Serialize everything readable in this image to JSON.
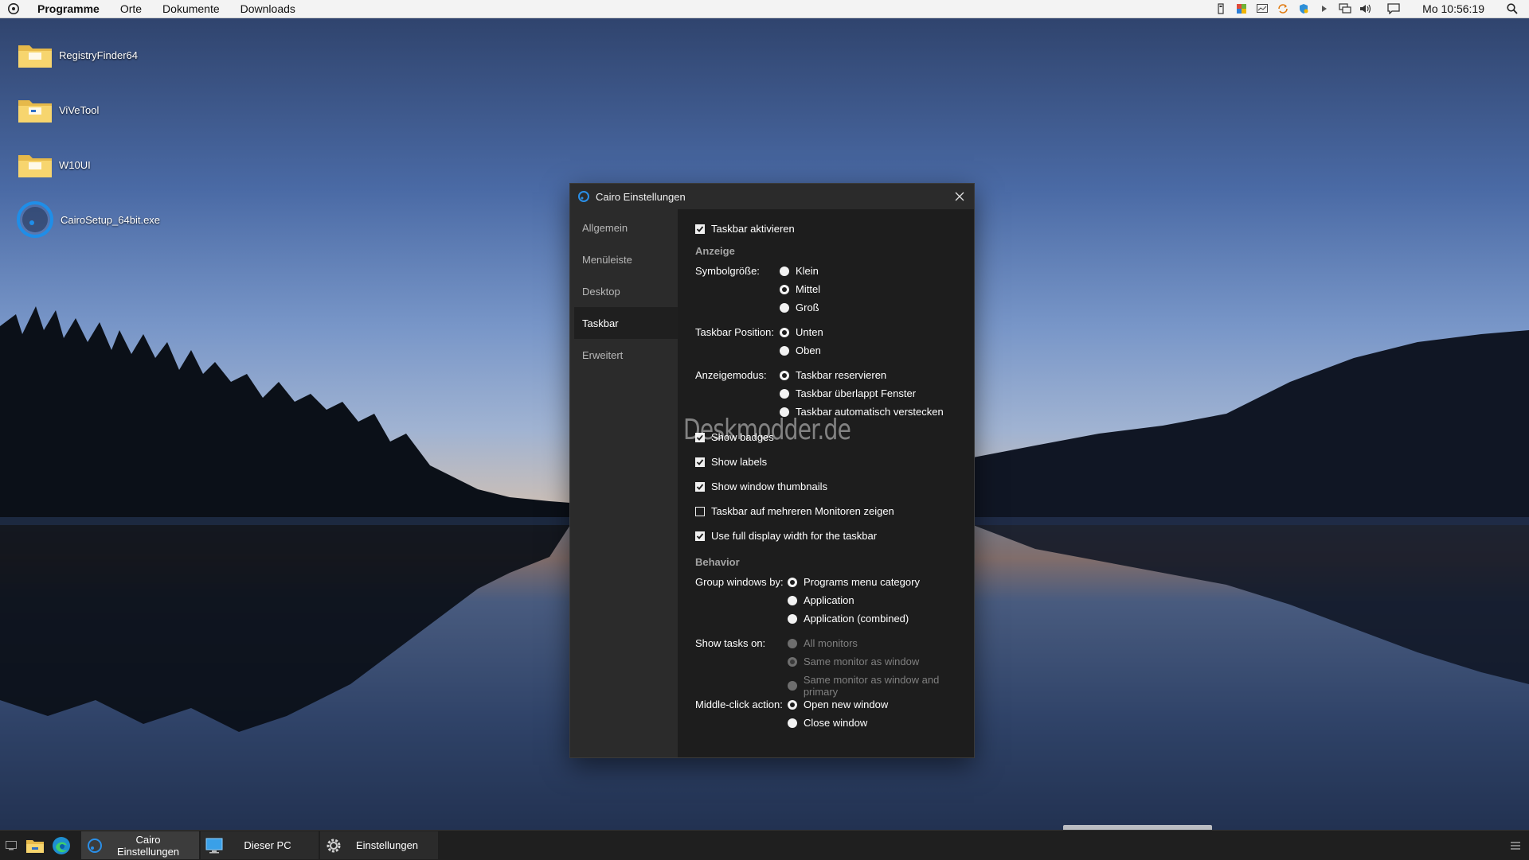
{
  "menubar": {
    "items": [
      "Programme",
      "Orte",
      "Dokumente",
      "Downloads"
    ],
    "clock": "Mo 10:56:19",
    "tray_icons": [
      "usb-icon",
      "color-flag-icon",
      "monitor-chart-icon",
      "sync-icon",
      "shield-icon",
      "chevron-right-icon",
      "network-icon",
      "volume-icon",
      "notification-icon"
    ]
  },
  "desktop": {
    "icons": [
      {
        "label": "RegistryFinder64",
        "icon": "folder-icon"
      },
      {
        "label": "ViVeTool",
        "icon": "folder-icon"
      },
      {
        "label": "W10UI",
        "icon": "folder-icon"
      },
      {
        "label": "CairoSetup_64bit.exe",
        "icon": "cairo-setup-icon"
      }
    ]
  },
  "window": {
    "title": "Cairo Einstellungen",
    "sidebar": [
      "Allgemein",
      "Menüleiste",
      "Desktop",
      "Taskbar",
      "Erweitert"
    ],
    "active_tab": "Taskbar",
    "taskbar_enable": {
      "label": "Taskbar aktivieren",
      "checked": true
    },
    "display": {
      "title": "Anzeige",
      "icon_size": {
        "label": "Symbolgröße:",
        "options": [
          "Klein",
          "Mittel",
          "Groß"
        ],
        "selected": "Mittel"
      },
      "position": {
        "label": "Taskbar Position:",
        "options": [
          "Unten",
          "Oben"
        ],
        "selected": "Unten"
      },
      "mode": {
        "label": "Anzeigemodus:",
        "options": [
          "Taskbar reservieren",
          "Taskbar überlappt Fenster",
          "Taskbar automatisch verstecken"
        ],
        "selected": "Taskbar reservieren"
      }
    },
    "checkboxes": [
      {
        "label": "Show badges",
        "checked": true
      },
      {
        "label": "Show labels",
        "checked": true
      },
      {
        "label": "Show window thumbnails",
        "checked": true
      },
      {
        "label": "Taskbar auf mehreren Monitoren zeigen",
        "checked": false
      },
      {
        "label": "Use full display width for the taskbar",
        "checked": true
      }
    ],
    "behavior": {
      "title": "Behavior",
      "group": {
        "label": "Group windows by:",
        "options": [
          "Programs menu category",
          "Application",
          "Application (combined)"
        ],
        "selected": "Programs menu category"
      },
      "tasks": {
        "label": "Show tasks on:",
        "options": [
          "All monitors",
          "Same monitor as window",
          "Same monitor as window and primary"
        ],
        "selected": "Same monitor as window",
        "disabled": true
      },
      "middle": {
        "label": "Middle-click action:",
        "options": [
          "Open new window",
          "Close window"
        ],
        "selected": "Open new window"
      }
    }
  },
  "watermark": "Deskmodder.de",
  "taskbar": {
    "buttons": [
      {
        "label": "Cairo Einstellungen",
        "icon": "cairo-icon",
        "active": true
      },
      {
        "label": "Dieser PC",
        "icon": "monitor-icon",
        "active": false
      },
      {
        "label": "Einstellungen",
        "icon": "gear-icon",
        "active": false
      }
    ]
  },
  "colors": {
    "window_bg": "#1d1d1d",
    "sidebar_bg": "#2b2b2b",
    "menubar_bg": "#f3f3f3",
    "taskbar_bg": "#1f1f1f"
  }
}
